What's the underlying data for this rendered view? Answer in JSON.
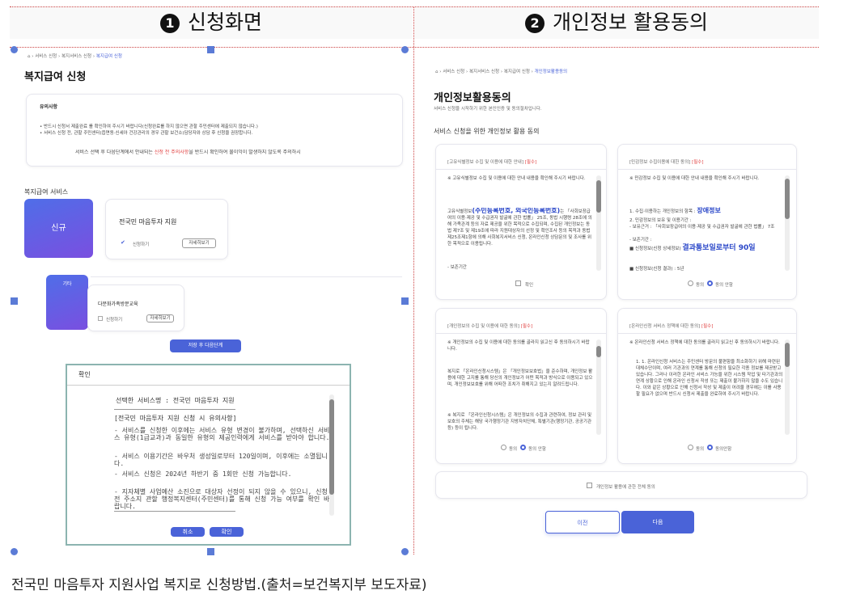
{
  "headers": {
    "left_num": "1",
    "left_title": "신청화면",
    "right_num": "2",
    "right_title": "개인정보 활용동의"
  },
  "left": {
    "breadcrumb": [
      "서비스 신청",
      "복지서비스 신청",
      "복지급여 신청"
    ],
    "page_title": "복지급여 신청",
    "notice_title": "유의사항",
    "notice_lines": [
      "• 반드시 신청서 제출완료 를 확인하여 주시기 바랍니다(신청완료를 하지 않으면 관할 주민센터에 제출되지 않습니다.)",
      "• 서비스 신청 전, 관할 주민센터(읍면동·신세아 건강관리의 경우 관할 보건소)담당자와 상담 후 신청을 권장합니다."
    ],
    "notice_footer_a": "서비스 선택 후 다음단계에서 안내되는 ",
    "notice_footer_b": "신청 전 주의사항",
    "notice_footer_c": "을 반드시 확인하여 불이익이 발생하지 않도록 주의하시",
    "section_title": "복지급여 서비스",
    "new_label": "신규",
    "service1": "전국민 마음투자 지원",
    "service1_check": "신청하기",
    "service1_btn": "자세히보기",
    "other_label": "기타",
    "service2": "다문화가족방문교육",
    "service2_check": "신청하기",
    "service2_btn": "자세히보기",
    "next_btn": "저장 후 다음단계",
    "dialog": {
      "title": "확인",
      "selected": "선택한 서비스명 : 전국민 마음투자 지원",
      "section": "[전국민 마음투자 지원 신청 시 유의사항]",
      "bullets": [
        "- 서비스를 신청한 이후에는 서비스 유형 변경이 불가하며, 선택하신 서비스 유형(1급교과)과 동일한 유형의 제공인력에게 서비스를 받아야 합니다.",
        "- 서비스 이용기간은 바우처 생성일로부터 120일이며, 이후에는 소멸됩니다.",
        "- 서비스 신청은 2024년 하반기 중 1회만 신청 가능합니다.",
        "- 지자체별 사업예산 소진으로 대상자 선정이 되지 않을 수 있으니, 신청 전 주소지 관할 행정복지센터(주민센터)를 통해 신청 가능 여부를 확인 바랍니다."
      ],
      "cancel": "취소",
      "ok": "확인"
    }
  },
  "right": {
    "breadcrumb": [
      "서비스 신청",
      "복지서비스 신청",
      "복지급여 신청",
      "개인정보활용동의"
    ],
    "page_title": "개인정보활용동의",
    "page_sub": "서비스 신청을 시작하기 위한 본인인증 및 동의절차입니다.",
    "section_title": "서비스 신청을 위한 개인정보 활용 동의",
    "boxes": [
      {
        "title": "[고유식별정보 수집 및 이용에 대한 안내]",
        "req": "[필수]",
        "intro": "※ 고유식별정보 수집 및 이용에 대한 안내 내용을 확인해 주시기 바랍니다.",
        "highlight": "(주민등록번호, 외국인등록번호)",
        "body_pre": "고유식별정보",
        "body": "는 「사회보장급여의 이용·제공 및 수급권자 발굴에 관한 법률」 25조, 동법 시행령 28조에 의해 가족관계 등의 자료 제공을 위한 목적으로 수집되며, 수집된 개인정보는 동법 제7조 및 제19조에 따라 지원대상자의 선정 및 확인조사 등의 목적과 동법 제25조제1항에 의해 사회복지서비스 신청, 온라인신청 상담문의 및 조사를 위한 목적으로 이용됩니다.",
        "tail": "- 보존기간",
        "opt1": "확인"
      },
      {
        "title": "[민감정보 수집이용에 대한 동의]",
        "req": "[필수]",
        "intro": "※ 민감정보 수집 및 이용에 대한 안내 내용을 확인해 주시기 바랍니다.",
        "line1": "1. 수집·이용하는 개인정보의 항목 :",
        "line1_hl": "장애정보",
        "line2": "2. 민감정보의 보유 및 이용기간 :",
        "line3": "- 보유근거 : 「사회보장급여의 이용·제공 및 수급권자 발굴에 관한 법률」 7조",
        "line4": "- 보존기간 :",
        "line5": "■ 신청정보(신청 상세정보)",
        "line5_hl": "결과통보일로부터 90일",
        "line6": "■ 신청정보(신청 결과) : 5년",
        "opt1": "동의",
        "opt2": "동의 안함"
      },
      {
        "title": "[개인정보의 수집 및 이용에 대한 동의]",
        "req": "[필수]",
        "intro": "※ 개인정보의 수집 및 이용에 대한 동의를 골라지 읽고신 후 동의하시기 바랍니다.",
        "body": "복지로 「온라인신청시스템」은 「개인정보보호법」을 준수하며, 개인정보 활용에 대한 고지를 통해 당신의 개인정보가 어떤 목적과 방식으로 이용되고 있으며, 개인정보보호를 위해 어떠한 조치가 취해지고 있는지 알려드립니다.",
        "body2": "※ 복지로 「온라인신청시스템」은 개인정보의 수집과 관련하여, 정보 관리 및 보호의 주체는 해당 국가행정기관 지방자치단체, 특별기관(행정기관, 공공기관 등) 등이 됩니다.",
        "opt1": "동의",
        "opt2": "동의 안함"
      },
      {
        "title": "[온라인신청 서비스 정책에 대한 동의]",
        "req": "[필수]",
        "intro": "※ 온라인신청 서비스 정책에 대한 동의를 골라지 읽고신 후 동의하시기 바랍니다.",
        "body": "1. 1. 온라인신청 서비스는 주민센터 방문의 불편함을 최소화하기 위해 마련된 대체수단이며, 여러 기관과의 연계를 통해 신청의 필요한 각종 정보를 제공받고 있습니다. 그러나 이러한 온라인 서비스 가능을 위한 시스템 작업 및 타기관과의 연계 상황으로 인해 온라인 신청서 작성 또는 제출이 불가하지 않을 수도 있습니다. 이와 같은 상황으로 인해 신청서 작성 및 제출이 어려울 경우에는 이를 사용할 필요가 없으며 반드시 신청서 제출을 완료하여 주시기 바랍니다.",
        "opt1": "동의",
        "opt2": "동의안함"
      }
    ],
    "all_agree": "개인정보 활용에 관한 전체 동의",
    "prev_btn": "이전",
    "next_btn": "다음"
  },
  "caption": "전국민 마음투자 지원사업 복지로 신청방법.(출처=보건복지부 보도자료)"
}
